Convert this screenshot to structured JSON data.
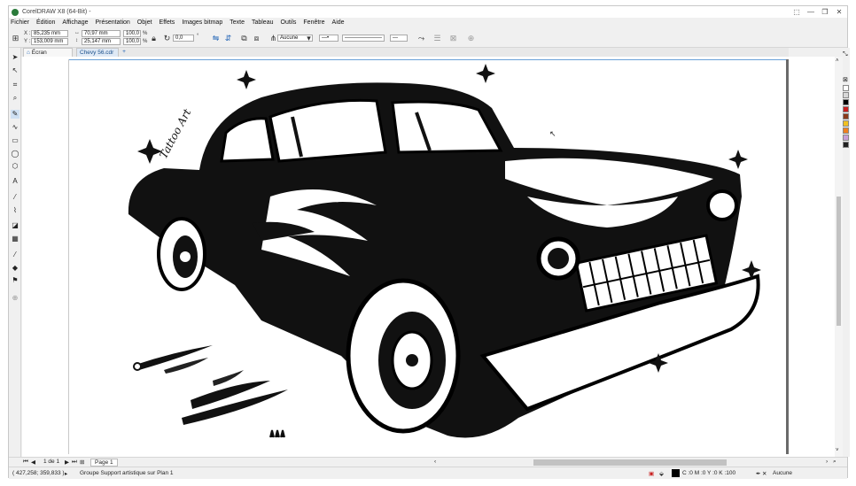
{
  "window": {
    "title": "CorelDRAW X8 (64-Bit) - ",
    "controls": [
      "—",
      "❐",
      "✕"
    ],
    "extra_icon": "⬚"
  },
  "menubar": [
    "Fichier",
    "Édition",
    "Affichage",
    "Présentation",
    "Objet",
    "Effets",
    "Images bitmap",
    "Texte",
    "Tableau",
    "Outils",
    "Fenêtre",
    "Aide"
  ],
  "propbar": {
    "x_label": "X :",
    "x_value": "85,235 mm",
    "y_label": "Y :",
    "y_value": "153,009 mm",
    "w_value": "70,97 mm",
    "h_value": "25,147 mm",
    "scale_x": "100,0",
    "scale_y": "100,0",
    "percent": "%",
    "rotation": "0,0",
    "degree": "°",
    "wrap_value": "Aucune"
  },
  "tabs": {
    "home_label": "Écran d'accueil",
    "doc_label": "Chevy 56.cdr",
    "add_label": "+"
  },
  "docnav": {
    "page_of": "1  de  1",
    "page_tab": "Page 1"
  },
  "status": {
    "coords": "( 427,258; 359,833 )",
    "arrow": "▸",
    "selection": "Groupe Support artistique sur Plan 1",
    "fill_info": "C :0 M :0 Y :0 K :100",
    "outline": "Aucune"
  },
  "signature_text": "Tattoo Art",
  "palette_colors": [
    "#ffffff",
    "#d8d8d8",
    "#000000",
    "#c81e1e",
    "#8a3a1a",
    "#f0c020",
    "#f08020",
    "#c8a0d8",
    "#202020"
  ],
  "colors": {
    "accent": "#1a5fb4",
    "canvas": "#ffffff",
    "chrome": "#f0f0f0"
  }
}
